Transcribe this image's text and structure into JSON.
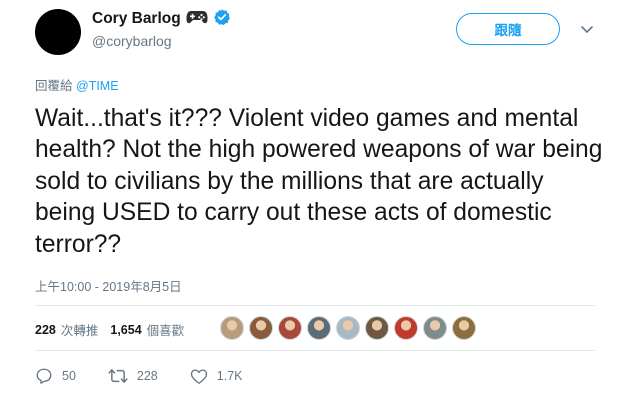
{
  "author": {
    "display_name": "Cory Barlog",
    "handle": "@corybarlog"
  },
  "follow_button_label": "跟隨",
  "reply_to": {
    "prefix": "回覆給",
    "mention": "@TIME"
  },
  "tweet_text": "Wait...that's it??? Violent video games and mental health? Not the high powered weapons of war being sold to civilians by the millions that are actually being USED to carry out these acts of domestic terror??",
  "timestamp": "上午10:00 - 2019年8月5日",
  "stats": {
    "retweets_count": "228",
    "retweets_label": "次轉推",
    "likes_count": "1,654",
    "likes_label": "個喜歡"
  },
  "liker_avatars": [
    {
      "color": "#b89a7e"
    },
    {
      "color": "#8a5a3c"
    },
    {
      "color": "#a8473a"
    },
    {
      "color": "#5c6b78"
    },
    {
      "color": "#aab8c2"
    },
    {
      "color": "#6e5844"
    },
    {
      "color": "#c0392b"
    },
    {
      "color": "#7f8c8d"
    },
    {
      "color": "#8a6e3b"
    }
  ],
  "actions": {
    "reply_count": "50",
    "retweet_count": "228",
    "like_count": "1.7K"
  },
  "colors": {
    "accent": "#1da1f2",
    "muted": "#657786",
    "text": "#14171a",
    "gamepad": "#292f33",
    "verified": "#1da1f2"
  }
}
